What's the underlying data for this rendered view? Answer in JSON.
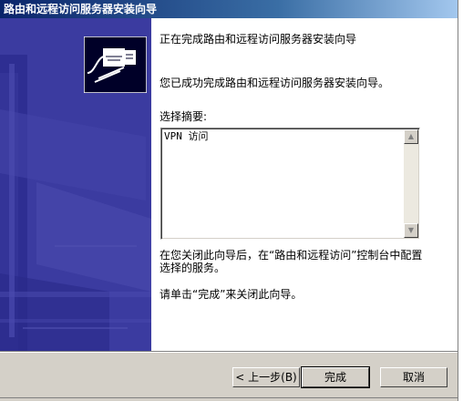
{
  "window": {
    "title": "路由和远程访问服务器安装向导"
  },
  "banner": {
    "icon": "network-cable-icon",
    "background_color": "#3b3ba0"
  },
  "content": {
    "heading": "正在完成路由和远程访问服务器安装向导",
    "success_message": "您已成功完成路由和远程访问服务器安装向导。",
    "summary_label": "选择摘要:",
    "summary_text": "VPN 访问",
    "closing_note": "在您关闭此向导后，在“路由和远程访问”控制台中配置选择的服务。",
    "finish_instruction": "请单击“完成”来关闭此向导。"
  },
  "buttons": {
    "back": "< 上一步(B)",
    "finish": "完成",
    "cancel": "取消"
  },
  "scrollbar": {
    "up_icon": "scroll-up-arrow-icon",
    "down_icon": "scroll-down-arrow-icon"
  }
}
